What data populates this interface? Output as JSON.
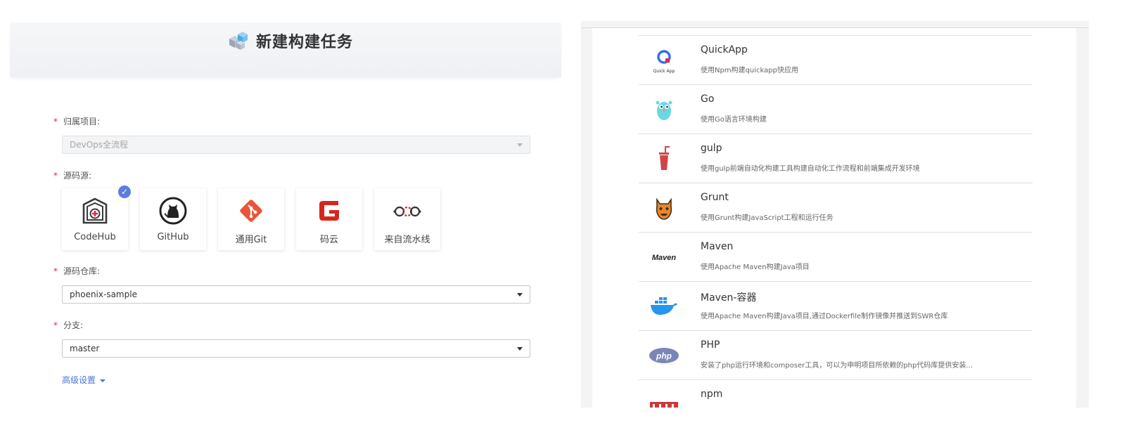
{
  "left": {
    "title": "新建构建任务",
    "fields": {
      "project": {
        "label": "归属项目:",
        "value": "DevOps全流程"
      },
      "source": {
        "label": "源码源:"
      },
      "repo": {
        "label": "源码仓库:",
        "value": "phoenix-sample"
      },
      "branch": {
        "label": "分支:",
        "value": "master"
      }
    },
    "required_mark": "*",
    "sources": [
      {
        "label": "CodeHub",
        "icon": "codehub-icon",
        "selected": true
      },
      {
        "label": "GitHub",
        "icon": "github-icon",
        "selected": false
      },
      {
        "label": "通用Git",
        "icon": "git-icon",
        "selected": false
      },
      {
        "label": "码云",
        "icon": "gitee-icon",
        "selected": false
      },
      {
        "label": "来自流水线",
        "icon": "pipeline-icon",
        "selected": false
      }
    ],
    "check_glyph": "✓",
    "advanced": "高级设置"
  },
  "right": {
    "templates": [
      {
        "name": "QuickApp",
        "desc": "使用Npm构建quickapp快应用",
        "icon": "quickapp-icon",
        "icon_text": "Quick App"
      },
      {
        "name": "Go",
        "desc": "使用Go语言环境构建",
        "icon": "go-gopher-icon"
      },
      {
        "name": "gulp",
        "desc": "使用gulp前端自动化构建工具构建自动化工作流程和前端集成开发环境",
        "icon": "gulp-icon"
      },
      {
        "name": "Grunt",
        "desc": "使用Grunt构建JavaScript工程和运行任务",
        "icon": "grunt-icon"
      },
      {
        "name": "Maven",
        "desc": "使用Apache Maven构建Java项目",
        "icon": "maven-icon",
        "icon_text": "Maven"
      },
      {
        "name": "Maven-容器",
        "desc": "使用Apache Maven构建Java项目,通过Dockerfile制作镜像并推送到SWR仓库",
        "icon": "docker-icon"
      },
      {
        "name": "PHP",
        "desc": "安装了php运行环境和composer工具，可以为申明项目所依赖的php代码库提供安装...",
        "icon": "php-icon",
        "icon_text": "php"
      },
      {
        "name": "npm",
        "desc": "",
        "icon": "npm-icon"
      }
    ]
  },
  "colors": {
    "required": "#e0294a",
    "link": "#4a73d1",
    "check": "#5a7ee0",
    "gitee_red": "#d9261c",
    "git_orange": "#e9553a"
  }
}
